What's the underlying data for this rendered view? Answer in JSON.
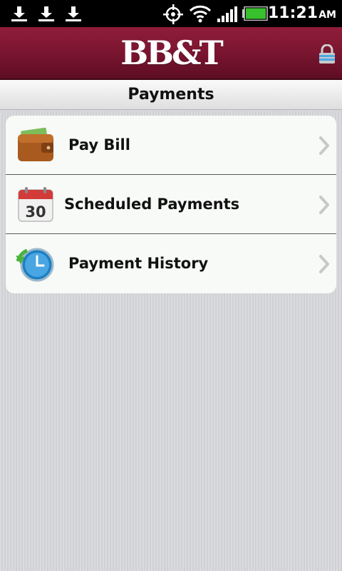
{
  "status_bar": {
    "time": "11:21",
    "ampm": "AM",
    "icons": [
      "download-icon",
      "download-icon",
      "download-icon",
      "gps-icon",
      "wifi-icon",
      "signal-icon",
      "battery-icon"
    ]
  },
  "header": {
    "logo_text": "BB&T",
    "lock_icon": "lock-icon",
    "colors": {
      "brand": "#7a1530"
    }
  },
  "page": {
    "title": "Payments"
  },
  "menu": {
    "items": [
      {
        "label": "Pay Bill",
        "icon": "wallet-icon"
      },
      {
        "label": "Scheduled Payments",
        "icon": "calendar-icon",
        "icon_text": "30"
      },
      {
        "label": "Payment History",
        "icon": "clock-history-icon"
      }
    ],
    "chevron_icon": "chevron-right-icon"
  }
}
